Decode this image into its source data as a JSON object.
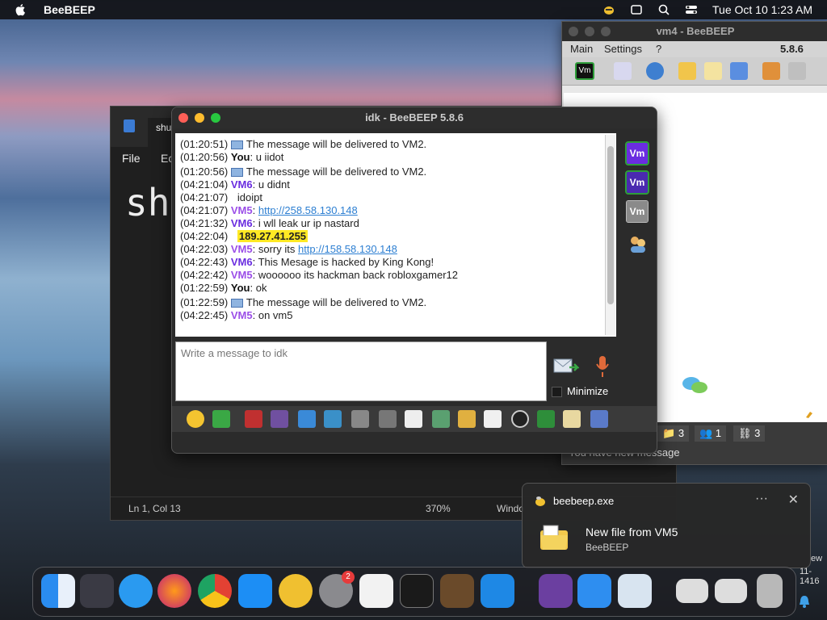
{
  "menubar": {
    "app_name": "BeeBEEP",
    "clock": "Tue Oct 10  1:23 AM"
  },
  "notepad": {
    "tab_label": "shu",
    "menu": [
      "File",
      "Ec"
    ],
    "content": "sh",
    "status": {
      "position": "Ln 1, Col 13",
      "zoom": "370%",
      "line_ending": "Windo"
    }
  },
  "vm4_window": {
    "title": "vm4 - BeeBEEP",
    "menu": [
      "Main",
      "Settings",
      "?"
    ],
    "version": "5.8.6",
    "counts": [
      "3",
      "1",
      "3"
    ],
    "new_message_text": "You have new message"
  },
  "idk_window": {
    "title": "idk - BeeBEEP 5.8.6",
    "messages": [
      {
        "time": "(01:20:51)",
        "kind": "system",
        "text": "The message will be delivered to VM2."
      },
      {
        "time": "(01:20:56)",
        "kind": "you",
        "sender": "You",
        "text": ": u iidot"
      },
      {
        "time": "(01:20:56)",
        "kind": "system",
        "text": "The message will be delivered to VM2."
      },
      {
        "time": "(04:21:04)",
        "kind": "vm6",
        "sender": "VM6",
        "text": ": u didnt"
      },
      {
        "time": "(04:21:07)",
        "kind": "plain",
        "text": "idoipt"
      },
      {
        "time": "(04:21:07)",
        "kind": "vm5link",
        "sender": "VM5",
        "link": "http://258.58.130.148"
      },
      {
        "time": "(04:21:32)",
        "kind": "vm6",
        "sender": "VM6",
        "text": ": i wll leak ur ip nastard"
      },
      {
        "time": "(04:22:04)",
        "kind": "highlight",
        "text": "189.27.41.255"
      },
      {
        "time": "(04:22:03)",
        "kind": "vm5text_link",
        "sender": "VM5",
        "text": ": sorry its ",
        "link": "http://158.58.130.148"
      },
      {
        "time": "(04:22:43)",
        "kind": "vm6",
        "sender": "VM6",
        "text": ": This Mesage is hacked by King Kong!"
      },
      {
        "time": "(04:22:42)",
        "kind": "vm5",
        "sender": "VM5",
        "text": ": woooooo its hackman back robloxgamer12"
      },
      {
        "time": "(01:22:59)",
        "kind": "you",
        "sender": "You",
        "text": ": ok"
      },
      {
        "time": "(01:22:59)",
        "kind": "system",
        "text": "The message will be delivered to VM2."
      },
      {
        "time": "(04:22:45)",
        "kind": "vm5",
        "sender": "VM5",
        "text": ": on vm5"
      }
    ],
    "input_placeholder": "Write a message to idk",
    "minimize_label": "Minimize",
    "users": [
      "Vm",
      "Vm",
      "Vm"
    ]
  },
  "notification": {
    "app": "beebeep.exe",
    "title": "New file from VM5",
    "body": "BeeBEEP",
    "more": "···",
    "close": "✕"
  },
  "dock": {
    "settings_badge": "2"
  },
  "edge_text": [
    "ew",
    "11-1416"
  ]
}
